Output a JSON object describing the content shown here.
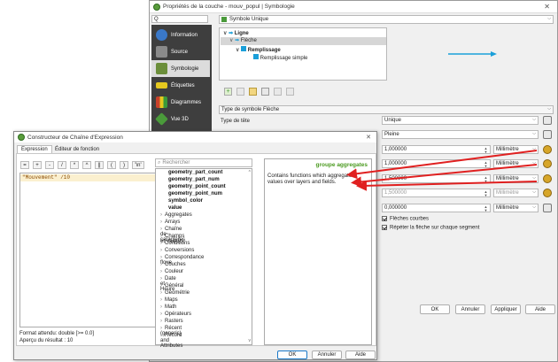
{
  "layer_props": {
    "title": "Propriétés de la couche - mouv_popul | Symbologie",
    "search_placeholder": "Q",
    "sidebar": [
      {
        "label": "Information",
        "color": "#3a78c8"
      },
      {
        "label": "Source",
        "color": "#7a7a7a"
      },
      {
        "label": "Symbologie",
        "color": "#6b8e3a"
      },
      {
        "label": "Étiquettes",
        "color": "#e5c81f"
      },
      {
        "label": "Diagrammes",
        "color": "#c8402a"
      },
      {
        "label": "Vue 3D",
        "color": "#4a9a3a"
      }
    ],
    "renderer": "Symbole Unique",
    "tree": [
      "Ligne",
      "Flèche",
      "Remplissage",
      "Remplissage simple"
    ],
    "symbol_type_label": "Type de symbole",
    "symbol_type_value": "Flèche",
    "head_type_label": "Type de tête",
    "head_type_value": "Unique",
    "arrow_type_value": "Pleine",
    "rows": [
      {
        "value": "1,000000",
        "unit": "Millimètre"
      },
      {
        "value": "1,000000",
        "unit": "Millimètre"
      },
      {
        "value": "1,500000",
        "unit": "Millimètre"
      },
      {
        "value": "1,500000",
        "unit": "Millimètre"
      },
      {
        "value": "0,000000",
        "unit": "Millimètre"
      }
    ],
    "check_curved": "Flèches courbes",
    "check_repeat": "Répéter la flèche sur chaque segment",
    "buttons": {
      "ok": "OK",
      "cancel": "Annuler",
      "apply": "Appliquer",
      "help": "Aide"
    }
  },
  "expr": {
    "title": "Constructeur de Chaîne d'Expression",
    "tabs": [
      "Expression",
      "Éditeur de fonction"
    ],
    "operators": [
      "=",
      "+",
      "-",
      "/",
      "*",
      "^",
      "||",
      "(",
      ")",
      "'\\n'"
    ],
    "expression": "\"Mouvement\" /10",
    "search_placeholder": "Rechercher",
    "functions": [
      "geometry_part_count",
      "geometry_part_num",
      "geometry_point_count",
      "geometry_point_num",
      "symbol_color",
      "value"
    ],
    "groups": [
      "Aggregates",
      "Arrays",
      "Chaîne de caractères",
      "Champs et Valeurs",
      "Conditions",
      "Conversions",
      "Correspondance floue",
      "Couches",
      "Couleur",
      "Date et Heure",
      "Général",
      "Géométrie",
      "Maps",
      "Math",
      "Opérateurs",
      "Rasters",
      "Récent (generic)",
      "Record and Attributes"
    ],
    "help_title": "groupe aggregates",
    "help_text": "Contains functions which aggregate values over layers and fields.",
    "format_label": "Format attendu: double [>= 0.0]",
    "preview_label": "Aperçu du résultat :",
    "preview_value": "10",
    "buttons": {
      "ok": "OK",
      "cancel": "Annuler",
      "help": "Aide"
    }
  },
  "colors": {
    "accent": "#1a9fd9",
    "sidebar_bg": "#3e3e3e",
    "sidebar_selected": "#dcdcdc",
    "arrow_red": "#e02020",
    "group_green": "#4a9a1f"
  }
}
